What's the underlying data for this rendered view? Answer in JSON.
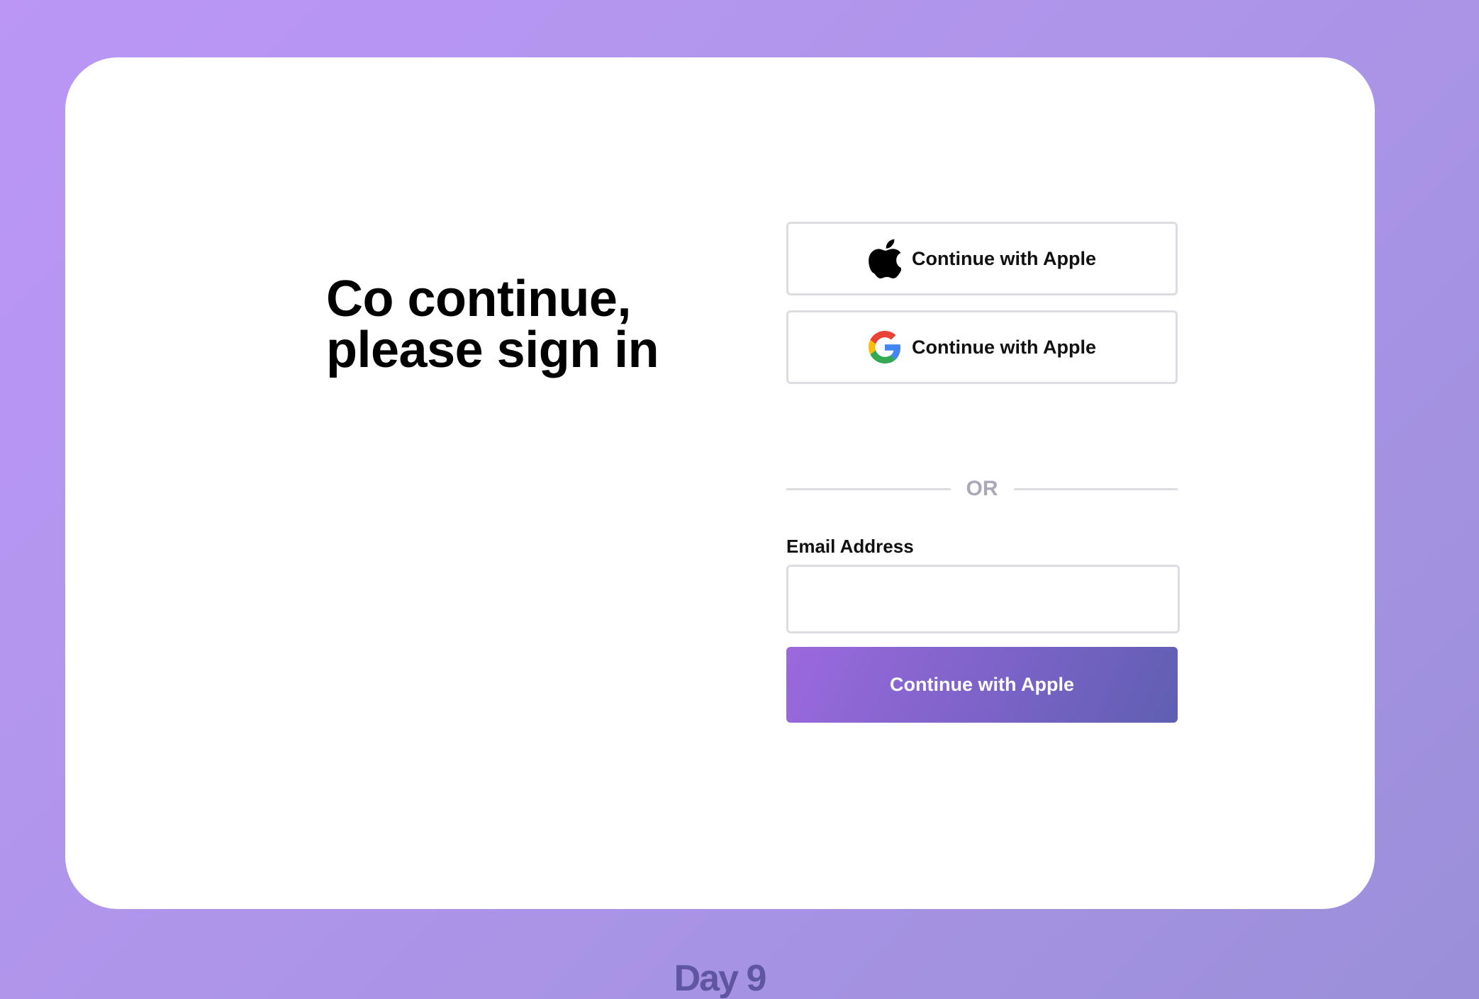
{
  "heading": {
    "line1": "Co continue,",
    "line2": "please sign in"
  },
  "social_buttons": [
    {
      "icon": "apple-icon",
      "label": "Continue with Apple"
    },
    {
      "icon": "google-icon",
      "label": "Continue with Apple"
    }
  ],
  "divider": {
    "text": "OR"
  },
  "email": {
    "label": "Email Address",
    "value": "",
    "placeholder": ""
  },
  "submit": {
    "label": "Continue with Apple"
  },
  "footer": {
    "title": "Day 9"
  },
  "colors": {
    "background_start": "#bb96f5",
    "background_end": "#9b8fd9",
    "card": "#ffffff",
    "border": "#dcdde2",
    "button_gradient_start": "#9b69dd",
    "button_gradient_end": "#5f5fb2",
    "footer_text": "#5f55a0"
  }
}
